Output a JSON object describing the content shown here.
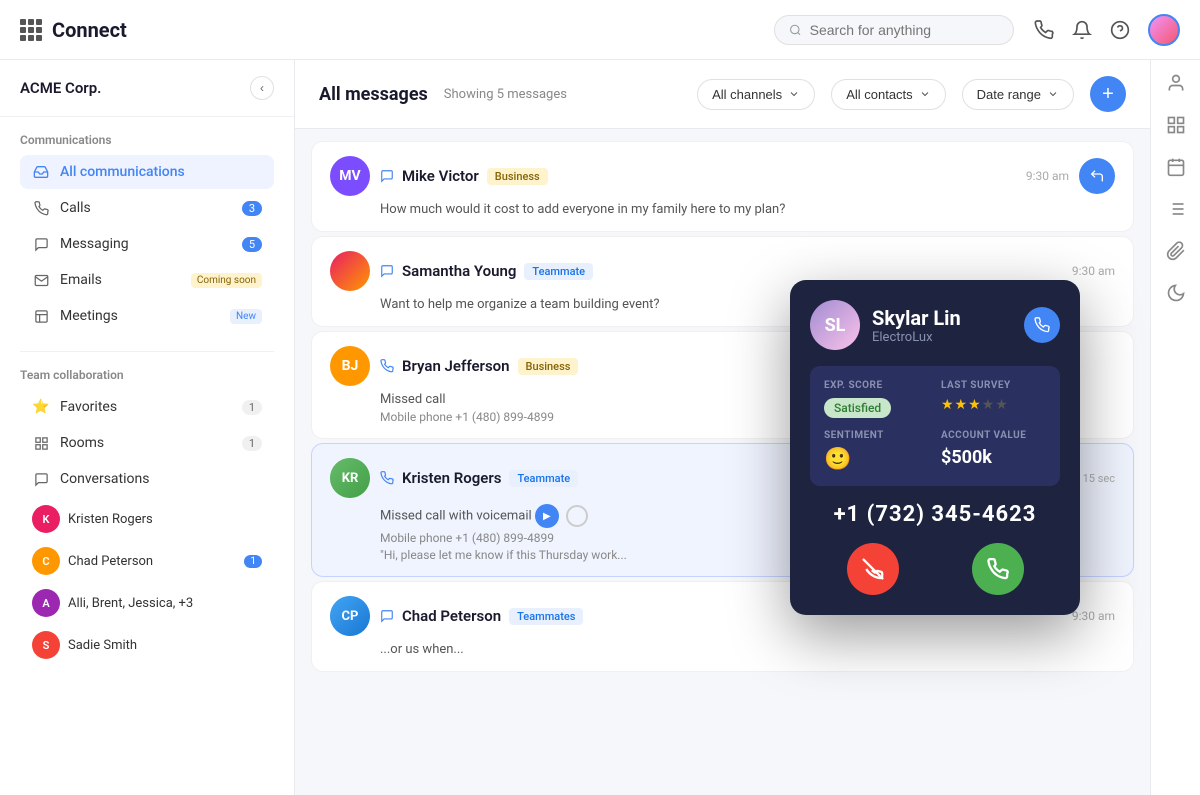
{
  "header": {
    "logo": "Connect",
    "search_placeholder": "Search for anything"
  },
  "sidebar": {
    "org_name": "ACME Corp.",
    "sections": {
      "communications": {
        "title": "Communications",
        "items": [
          {
            "label": "All communications",
            "icon": "📥",
            "active": true
          },
          {
            "label": "Calls",
            "badge": "3",
            "icon": "📞"
          },
          {
            "label": "Messaging",
            "badge": "5",
            "icon": "💬"
          },
          {
            "label": "Emails",
            "special": "Coming soon",
            "icon": "✉️"
          },
          {
            "label": "Meetings",
            "special": "New",
            "icon": "📋"
          }
        ]
      },
      "team_collaboration": {
        "title": "Team collaboration",
        "items": [
          {
            "label": "Favorites",
            "badge": "1",
            "icon": "⭐"
          },
          {
            "label": "Rooms",
            "badge": "1",
            "icon": "🏠"
          },
          {
            "label": "Conversations",
            "icon": "💬"
          }
        ]
      },
      "conversations": [
        {
          "name": "Kristen Rogers",
          "color": "#e91e63"
        },
        {
          "name": "Chad Peterson",
          "badge": "1",
          "color": "#ff9800"
        },
        {
          "name": "Alli, Brent, Jessica, +3",
          "color": "#9c27b0"
        },
        {
          "name": "Sadie Smith",
          "color": "#f44336"
        }
      ]
    }
  },
  "messages": {
    "title": "All messages",
    "showing": "Showing 5 messages",
    "filters": [
      "All channels",
      "All contacts",
      "Date range"
    ],
    "items": [
      {
        "id": 1,
        "name": "Mike Victor",
        "tag": "Business",
        "tag_type": "business",
        "avatar_initials": "MV",
        "avatar_color": "#7c4dff",
        "time": "9:30 am",
        "body": "How much would it cost to add everyone in my family here to my plan?",
        "icon": "chat",
        "has_reply": true
      },
      {
        "id": 2,
        "name": "Samantha Young",
        "tag": "Teammate",
        "tag_type": "teammate",
        "avatar_color": "#e91e63",
        "time": "9:30 am",
        "body": "Want to help me organize a team building event?",
        "icon": "chat"
      },
      {
        "id": 3,
        "name": "Bryan Jefferson",
        "tag": "Business",
        "tag_type": "business",
        "avatar_initials": "BJ",
        "avatar_color": "#ff9800",
        "time": "",
        "body": "Missed call",
        "body2": "Mobile phone +1 (480) 899-4899",
        "icon": "phone"
      },
      {
        "id": 4,
        "name": "Kristen Rogers",
        "tag": "Teammate",
        "tag_type": "teammate",
        "avatar_color": "#4caf50",
        "time": "15 sec",
        "body": "Missed call with voicemail",
        "body2": "Mobile phone +1 (480) 899-4899",
        "body3": "\"Hi, please let me know if this Thursday work...",
        "icon": "phone",
        "has_voicemail": true
      },
      {
        "id": 5,
        "name": "Chad Peterson",
        "tag": "Teammates",
        "tag_type": "teammates",
        "avatar_color": "#2196f3",
        "time": "9:30 am",
        "body": "...or us when...",
        "icon": "chat"
      }
    ]
  },
  "popup": {
    "name": "Skylar Lin",
    "company": "ElectroLux",
    "phone": "+1 (732) 345-4623",
    "exp_score_label": "EXP. SCORE",
    "exp_score_value": "Satisfied",
    "last_survey_label": "LAST SURVEY",
    "stars": 3,
    "sentiment_label": "SENTIMENT",
    "sentiment_emoji": "🙂",
    "account_value_label": "ACCOUNT VALUE",
    "account_value": "$500k"
  }
}
